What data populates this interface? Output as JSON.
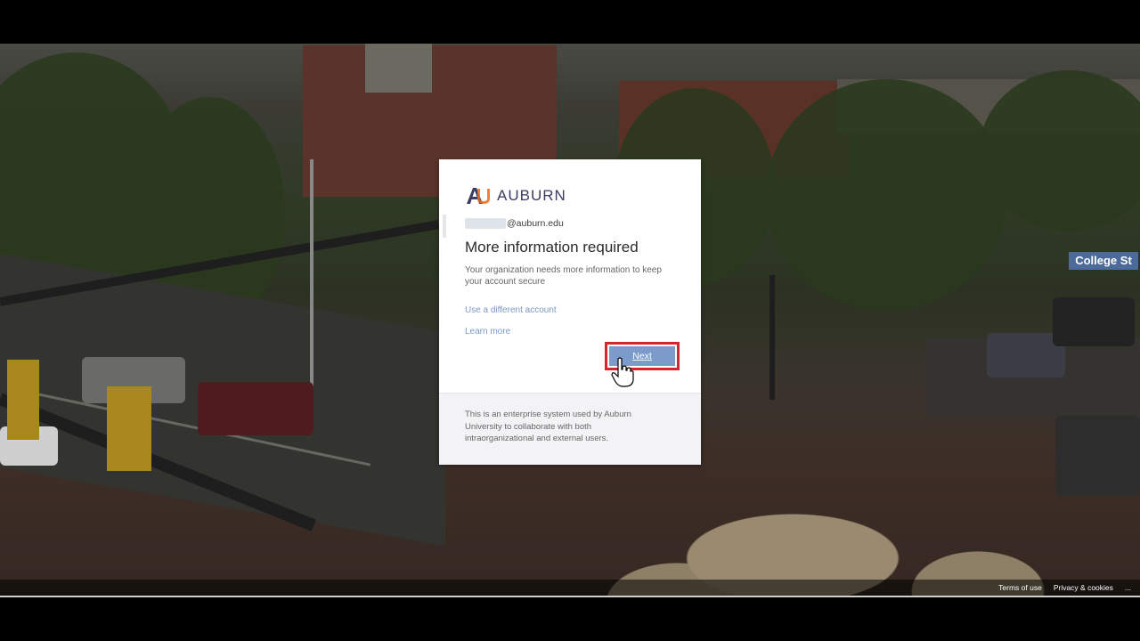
{
  "org": {
    "logo_text": "AUBURN",
    "brand_color": "#3b3d62",
    "accent_color": "#e86d1f"
  },
  "signin": {
    "identity_suffix": "auburn.edu",
    "title": "More information required",
    "description": "Your organization needs more information to keep your account secure",
    "use_different_account": "Use a different account",
    "learn_more": "Learn more",
    "next_label": "Next",
    "footer_text": "This is an enterprise system used by Auburn University to collaborate with both intraorganizational and external users."
  },
  "page_footer": {
    "terms": "Terms of use",
    "privacy": "Privacy & cookies",
    "more": "..."
  },
  "background": {
    "street_sign": "College St"
  },
  "colors": {
    "button": "#7b9bcb",
    "highlight": "#d9232e",
    "link": "#7a9ac2"
  }
}
